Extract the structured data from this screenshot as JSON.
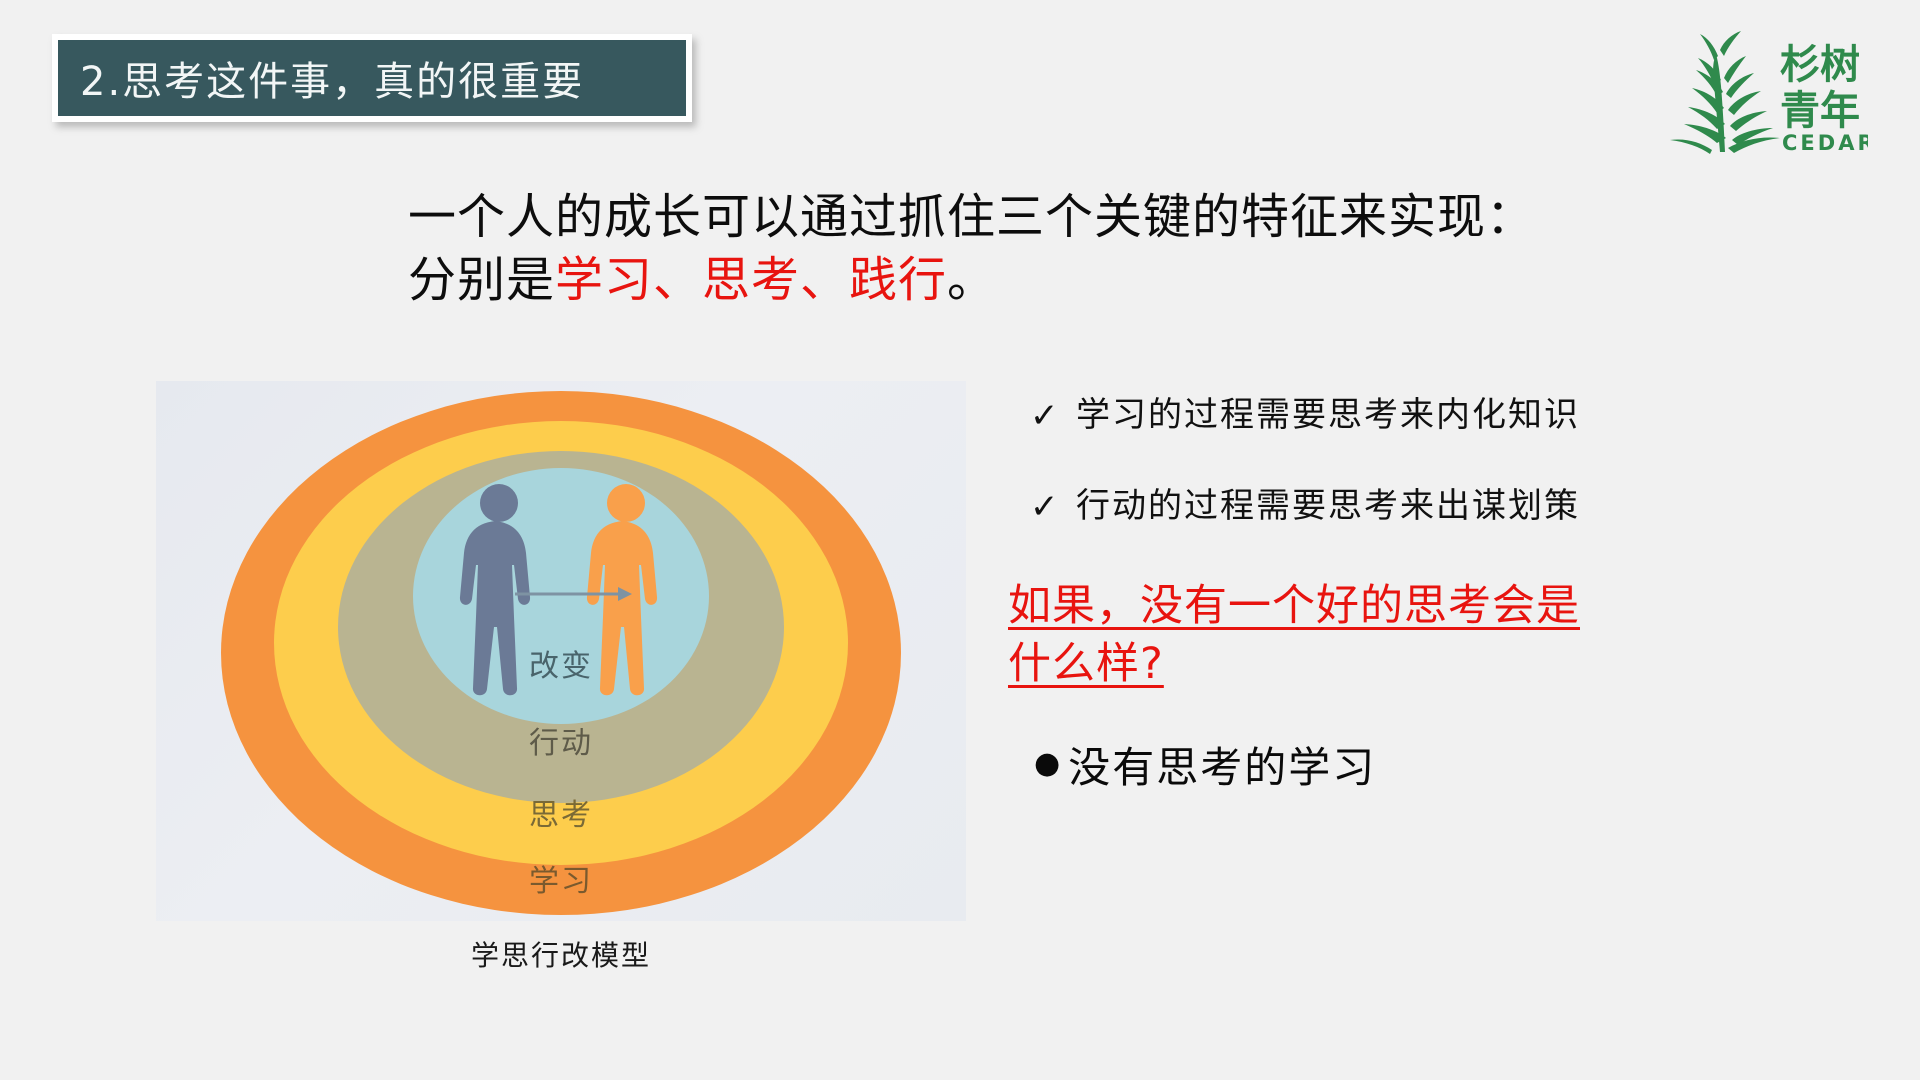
{
  "slide": {
    "background_color": "#f1f1f1",
    "title": {
      "text": "2.思考这件事，真的很重要",
      "background_color": "#37585e",
      "text_color": "#f2f6f6",
      "border_color": "#ffffff"
    },
    "logo": {
      "name": "cedar-youth-logo",
      "chinese_line1": "杉树",
      "chinese_line2": "青年",
      "latin": "CEDAR",
      "color": "#2f8a4c"
    },
    "headline": {
      "line1": "一个人的成长可以通过抓住三个关键的特征来实现：",
      "line2_prefix": "分别是",
      "line2_red": "学习、思考、践行",
      "line2_suffix": "。",
      "red_color": "#e8140f",
      "text_color": "#0d0d0d"
    },
    "diagram": {
      "caption": "学思行改模型",
      "panel_background": "#e9ecf1",
      "rings": [
        {
          "label": "学习",
          "color": "#f5933f",
          "label_color": "#7a5a2e"
        },
        {
          "label": "思考",
          "color": "#fdcd4c",
          "label_color": "#7a6a36"
        },
        {
          "label": "行动",
          "color": "#b9b491",
          "label_color": "#5e5b49"
        },
        {
          "label": "改变",
          "color": "#a8d5dc",
          "label_color": "#49646b"
        }
      ],
      "figures": [
        {
          "name": "person-before",
          "color": "#6b7a96"
        },
        {
          "name": "person-after",
          "color": "#f9a04b"
        }
      ],
      "arrow_color": "#7e93a3"
    },
    "right_column": {
      "checks": [
        {
          "mark": "✓",
          "text": "学习的过程需要思考来内化知识"
        },
        {
          "mark": "✓",
          "text": "行动的过程需要思考来出谋划策"
        }
      ],
      "question": {
        "line1": "如果，没有一个好的思考会是",
        "line2": "什么样?",
        "color": "#e8140f"
      },
      "bullet": {
        "mark": "●",
        "text": "没有思考的学习"
      }
    }
  }
}
